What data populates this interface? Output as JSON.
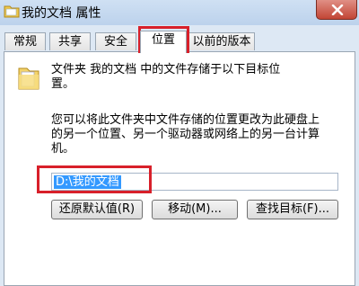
{
  "window": {
    "title": "我的文档 属性",
    "icons": {
      "app": "folder-icon",
      "close": "close-icon"
    }
  },
  "tabs": [
    {
      "label": "常规",
      "active": false
    },
    {
      "label": "共享",
      "active": false
    },
    {
      "label": "安全",
      "active": false
    },
    {
      "label": "位置",
      "active": true
    },
    {
      "label": "以前的版本",
      "active": false
    }
  ],
  "location": {
    "description_line1": "文件夹 我的文档 中的文件存储于以下目标位",
    "description_line2": "置。",
    "info_line1": "您可以将此文件夹中文件存储的位置更改为此硬盘上",
    "info_line2": "的另一个位置、另一个驱动器或网络上的另一台计算",
    "info_line3": "机。",
    "path_value": "D:\\我的文档",
    "buttons": {
      "restore_default": "还原默认值(R)",
      "move": "移动(M)...",
      "find_target": "查找目标(F)..."
    }
  },
  "colors": {
    "highlight": "#d8202a",
    "selection": "#3399ff"
  }
}
